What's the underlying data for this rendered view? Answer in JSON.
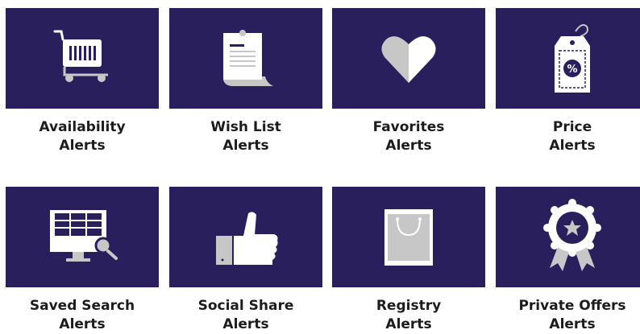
{
  "colors": {
    "tile_bg": "#291f5c",
    "label_text": "#1c1c1c",
    "icon_light": "#ffffff",
    "icon_gray": "#c7c7c7"
  },
  "alerts": [
    {
      "icon": "shopping-cart-icon",
      "line1": "Availability",
      "line2": "Alerts"
    },
    {
      "icon": "wish-list-scroll-icon",
      "line1": "Wish List",
      "line2": "Alerts"
    },
    {
      "icon": "heart-icon",
      "line1": "Favorites",
      "line2": "Alerts"
    },
    {
      "icon": "price-tag-icon",
      "line1": "Price",
      "line2": "Alerts",
      "tag_text": "%"
    },
    {
      "icon": "monitor-search-icon",
      "line1": "Saved Search",
      "line2": "Alerts"
    },
    {
      "icon": "thumbs-up-icon",
      "line1": "Social Share",
      "line2": "Alerts"
    },
    {
      "icon": "gift-bag-icon",
      "line1": "Registry",
      "line2": "Alerts"
    },
    {
      "icon": "award-ribbon-icon",
      "line1": "Private Offers",
      "line2": "Alerts"
    }
  ]
}
